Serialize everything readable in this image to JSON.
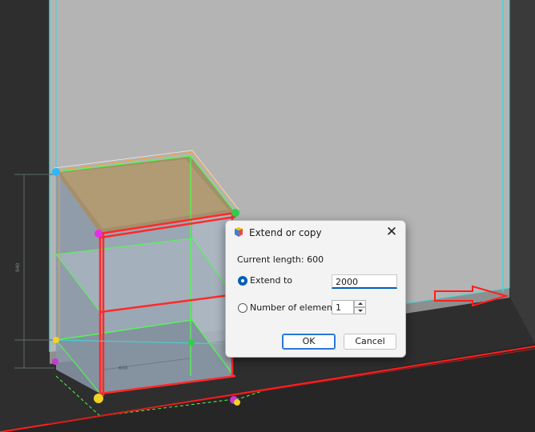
{
  "dialog": {
    "title": "Extend or copy",
    "close_symbol": "✕",
    "current_length_text": "Current length: 600",
    "extend_label": "Extend to",
    "extend_value": "2000",
    "count_label": "Number of elements",
    "count_value": "1",
    "ok_label": "OK",
    "cancel_label": "Cancel",
    "selected_option": "extend"
  },
  "scene": {
    "dimension_label": "600",
    "colors": {
      "background": "#2e2e2e",
      "wall": "#b3b3b3",
      "highlight_edge": "#ff2a2a",
      "selection": "#4cff4c",
      "guide": "#41d6d6",
      "arrow": "#ff1e1e"
    }
  },
  "icons": {
    "app": "app-logo-icon",
    "close": "close-icon",
    "direction_arrow": "arrow-right-icon"
  }
}
